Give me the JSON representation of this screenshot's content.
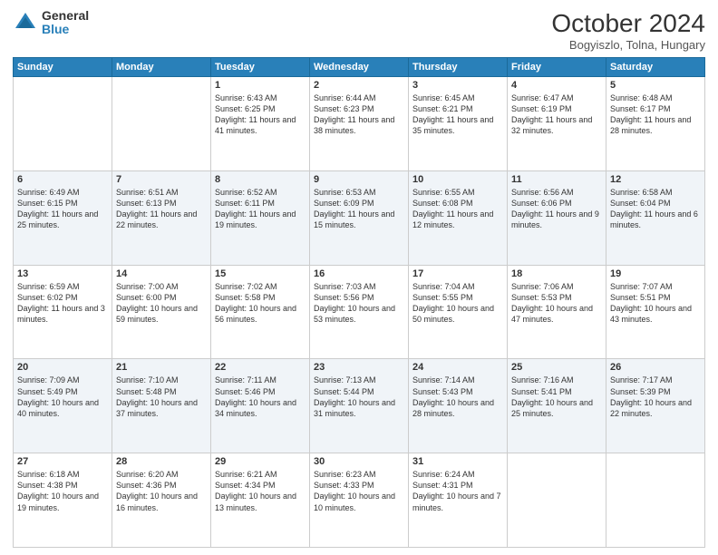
{
  "header": {
    "logo_general": "General",
    "logo_blue": "Blue",
    "month_title": "October 2024",
    "location": "Bogyiszlo, Tolna, Hungary"
  },
  "days_of_week": [
    "Sunday",
    "Monday",
    "Tuesday",
    "Wednesday",
    "Thursday",
    "Friday",
    "Saturday"
  ],
  "weeks": [
    [
      {
        "day": "",
        "info": ""
      },
      {
        "day": "",
        "info": ""
      },
      {
        "day": "1",
        "info": "Sunrise: 6:43 AM\nSunset: 6:25 PM\nDaylight: 11 hours and 41 minutes."
      },
      {
        "day": "2",
        "info": "Sunrise: 6:44 AM\nSunset: 6:23 PM\nDaylight: 11 hours and 38 minutes."
      },
      {
        "day": "3",
        "info": "Sunrise: 6:45 AM\nSunset: 6:21 PM\nDaylight: 11 hours and 35 minutes."
      },
      {
        "day": "4",
        "info": "Sunrise: 6:47 AM\nSunset: 6:19 PM\nDaylight: 11 hours and 32 minutes."
      },
      {
        "day": "5",
        "info": "Sunrise: 6:48 AM\nSunset: 6:17 PM\nDaylight: 11 hours and 28 minutes."
      }
    ],
    [
      {
        "day": "6",
        "info": "Sunrise: 6:49 AM\nSunset: 6:15 PM\nDaylight: 11 hours and 25 minutes."
      },
      {
        "day": "7",
        "info": "Sunrise: 6:51 AM\nSunset: 6:13 PM\nDaylight: 11 hours and 22 minutes."
      },
      {
        "day": "8",
        "info": "Sunrise: 6:52 AM\nSunset: 6:11 PM\nDaylight: 11 hours and 19 minutes."
      },
      {
        "day": "9",
        "info": "Sunrise: 6:53 AM\nSunset: 6:09 PM\nDaylight: 11 hours and 15 minutes."
      },
      {
        "day": "10",
        "info": "Sunrise: 6:55 AM\nSunset: 6:08 PM\nDaylight: 11 hours and 12 minutes."
      },
      {
        "day": "11",
        "info": "Sunrise: 6:56 AM\nSunset: 6:06 PM\nDaylight: 11 hours and 9 minutes."
      },
      {
        "day": "12",
        "info": "Sunrise: 6:58 AM\nSunset: 6:04 PM\nDaylight: 11 hours and 6 minutes."
      }
    ],
    [
      {
        "day": "13",
        "info": "Sunrise: 6:59 AM\nSunset: 6:02 PM\nDaylight: 11 hours and 3 minutes."
      },
      {
        "day": "14",
        "info": "Sunrise: 7:00 AM\nSunset: 6:00 PM\nDaylight: 10 hours and 59 minutes."
      },
      {
        "day": "15",
        "info": "Sunrise: 7:02 AM\nSunset: 5:58 PM\nDaylight: 10 hours and 56 minutes."
      },
      {
        "day": "16",
        "info": "Sunrise: 7:03 AM\nSunset: 5:56 PM\nDaylight: 10 hours and 53 minutes."
      },
      {
        "day": "17",
        "info": "Sunrise: 7:04 AM\nSunset: 5:55 PM\nDaylight: 10 hours and 50 minutes."
      },
      {
        "day": "18",
        "info": "Sunrise: 7:06 AM\nSunset: 5:53 PM\nDaylight: 10 hours and 47 minutes."
      },
      {
        "day": "19",
        "info": "Sunrise: 7:07 AM\nSunset: 5:51 PM\nDaylight: 10 hours and 43 minutes."
      }
    ],
    [
      {
        "day": "20",
        "info": "Sunrise: 7:09 AM\nSunset: 5:49 PM\nDaylight: 10 hours and 40 minutes."
      },
      {
        "day": "21",
        "info": "Sunrise: 7:10 AM\nSunset: 5:48 PM\nDaylight: 10 hours and 37 minutes."
      },
      {
        "day": "22",
        "info": "Sunrise: 7:11 AM\nSunset: 5:46 PM\nDaylight: 10 hours and 34 minutes."
      },
      {
        "day": "23",
        "info": "Sunrise: 7:13 AM\nSunset: 5:44 PM\nDaylight: 10 hours and 31 minutes."
      },
      {
        "day": "24",
        "info": "Sunrise: 7:14 AM\nSunset: 5:43 PM\nDaylight: 10 hours and 28 minutes."
      },
      {
        "day": "25",
        "info": "Sunrise: 7:16 AM\nSunset: 5:41 PM\nDaylight: 10 hours and 25 minutes."
      },
      {
        "day": "26",
        "info": "Sunrise: 7:17 AM\nSunset: 5:39 PM\nDaylight: 10 hours and 22 minutes."
      }
    ],
    [
      {
        "day": "27",
        "info": "Sunrise: 6:18 AM\nSunset: 4:38 PM\nDaylight: 10 hours and 19 minutes."
      },
      {
        "day": "28",
        "info": "Sunrise: 6:20 AM\nSunset: 4:36 PM\nDaylight: 10 hours and 16 minutes."
      },
      {
        "day": "29",
        "info": "Sunrise: 6:21 AM\nSunset: 4:34 PM\nDaylight: 10 hours and 13 minutes."
      },
      {
        "day": "30",
        "info": "Sunrise: 6:23 AM\nSunset: 4:33 PM\nDaylight: 10 hours and 10 minutes."
      },
      {
        "day": "31",
        "info": "Sunrise: 6:24 AM\nSunset: 4:31 PM\nDaylight: 10 hours and 7 minutes."
      },
      {
        "day": "",
        "info": ""
      },
      {
        "day": "",
        "info": ""
      }
    ]
  ]
}
